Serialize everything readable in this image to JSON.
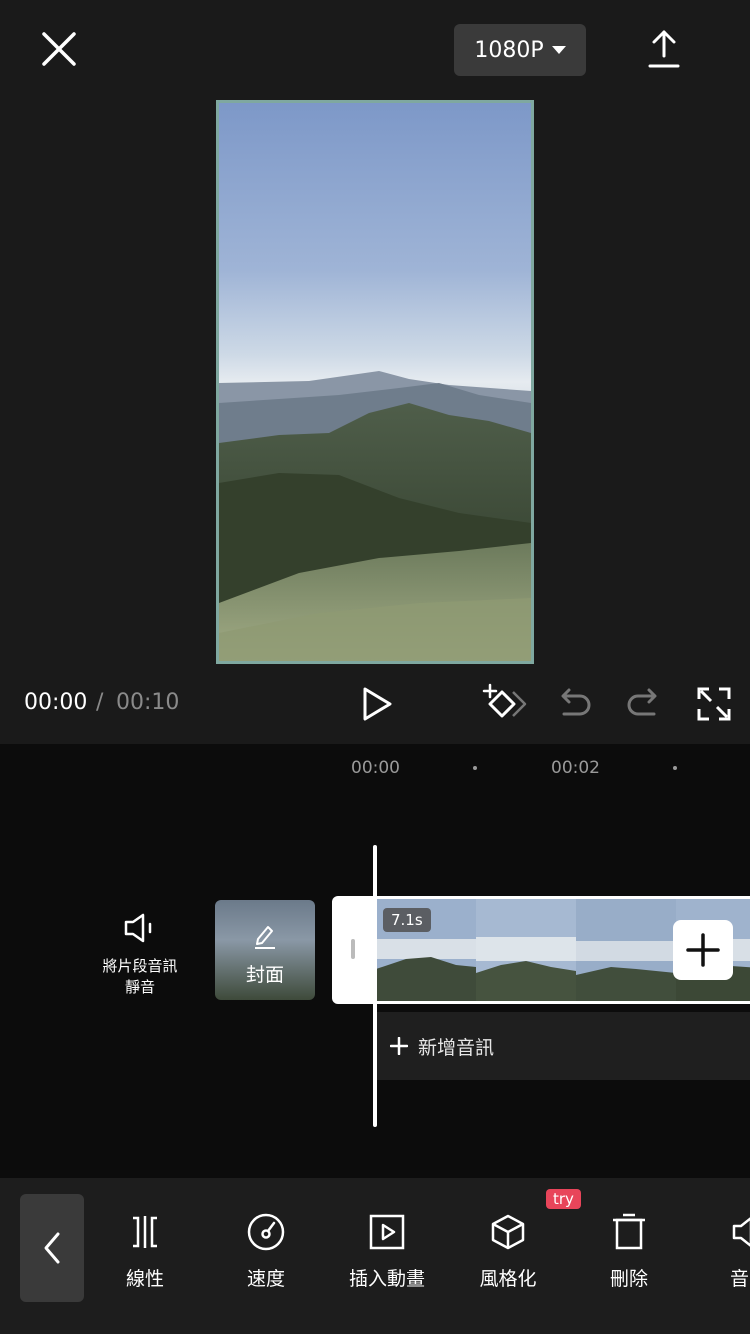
{
  "header": {
    "close_icon": "close-icon",
    "resolution": "1080P",
    "export_icon": "upload-icon"
  },
  "playback": {
    "current_time": "00:00",
    "separator": "/",
    "total_time": "00:10"
  },
  "timeline": {
    "ticks": [
      "00:00",
      "00:02"
    ],
    "mute_label_line1": "將片段音訊",
    "mute_label_line2": "靜音",
    "cover_label": "封面",
    "clip_duration": "7.1s",
    "add_audio_label": "新增音訊"
  },
  "toolbar": {
    "items": [
      {
        "label": "線性",
        "icon": "linear-icon"
      },
      {
        "label": "速度",
        "icon": "speed-icon"
      },
      {
        "label": "插入動畫",
        "icon": "insert-animation-icon"
      },
      {
        "label": "風格化",
        "icon": "stylize-icon"
      },
      {
        "label": "刪除",
        "icon": "delete-icon"
      },
      {
        "label": "音",
        "icon": "audio-icon"
      }
    ],
    "try_badge": "try"
  },
  "colors": {
    "background": "#1a1a1a",
    "timeline_bg": "#0c0c0c",
    "preview_border": "#7fa8a0",
    "try_badge": "#e8455a"
  }
}
